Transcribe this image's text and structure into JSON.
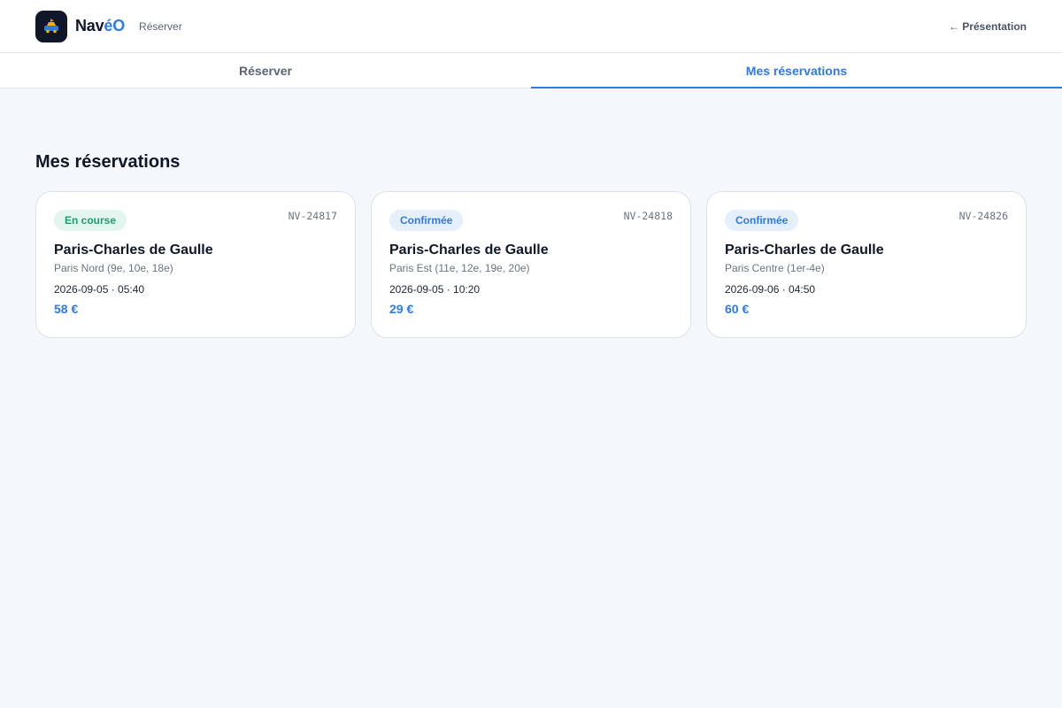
{
  "header": {
    "brand_prefix": "Nav",
    "brand_accent": "éO",
    "section_label": "Réserver",
    "back_link": "← Présentation",
    "logo_icon": "car-icon"
  },
  "tabs": [
    {
      "label": "Réserver",
      "active": false
    },
    {
      "label": "Mes réservations",
      "active": true
    }
  ],
  "main": {
    "title": "Mes réservations",
    "reservations": [
      {
        "status": "En course",
        "status_kind": "ongoing",
        "ref": "NV-24817",
        "destination": "Paris-Charles de Gaulle",
        "zone": "Paris Nord (9e, 10e, 18e)",
        "datetime": "2026-09-05 · 05:40",
        "price": "58 €"
      },
      {
        "status": "Confirmée",
        "status_kind": "confirmed",
        "ref": "NV-24818",
        "destination": "Paris-Charles de Gaulle",
        "zone": "Paris Est (11e, 12e, 19e, 20e)",
        "datetime": "2026-09-05 · 10:20",
        "price": "29 €"
      },
      {
        "status": "Confirmée",
        "status_kind": "confirmed",
        "ref": "NV-24826",
        "destination": "Paris-Charles de Gaulle",
        "zone": "Paris Centre (1er-4e)",
        "datetime": "2026-09-06 · 04:50",
        "price": "60 €"
      }
    ]
  },
  "colors": {
    "accent": "#2f7ae5",
    "ongoing": "#1a9e74",
    "background": "#f4f7fb",
    "text": "#0f1728"
  }
}
